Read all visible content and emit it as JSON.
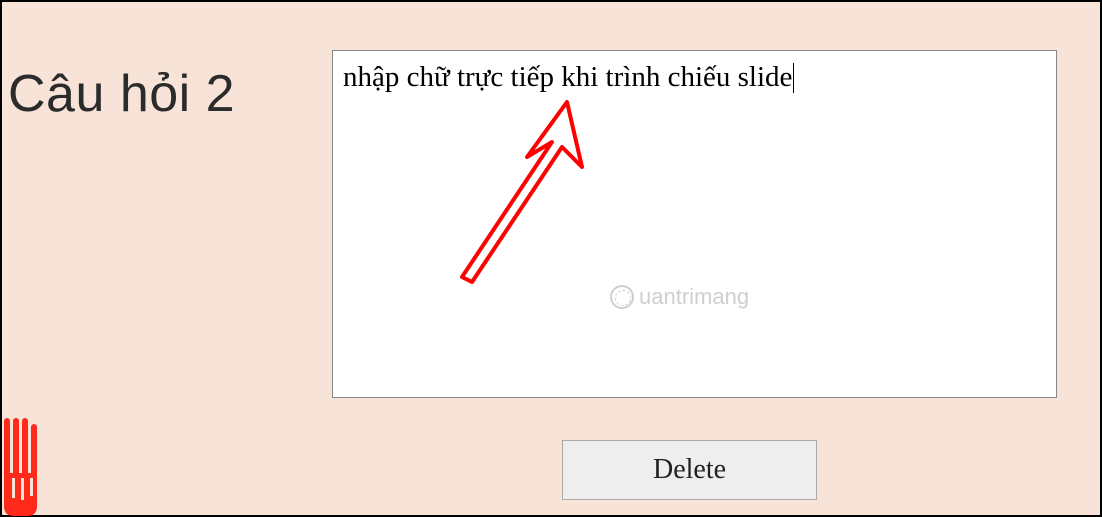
{
  "heading": "Câu hỏi 2",
  "textbox": {
    "value": "nhập chữ trực tiếp khi trình chiếu slide"
  },
  "button": {
    "delete_label": "Delete"
  },
  "watermark": {
    "text": "uantrimang"
  }
}
